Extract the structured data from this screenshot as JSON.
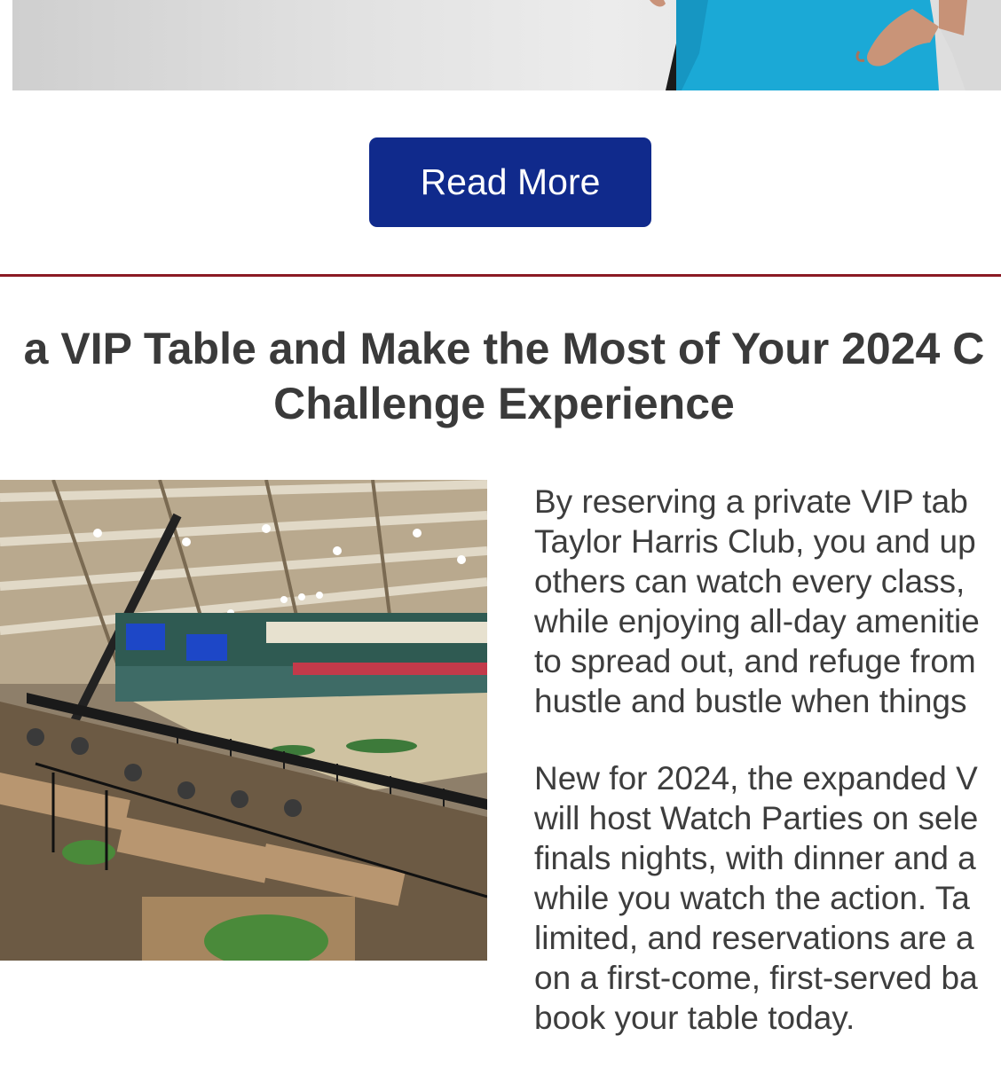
{
  "hero": {
    "image_description_icon": "person-photo-icon"
  },
  "cta": {
    "read_more_label": "Read More"
  },
  "section": {
    "headline_lines": [
      "a VIP Table and Make the Most of Your 2024 C",
      "Challenge Experience"
    ],
    "paragraph1_lines": [
      "By reserving a private VIP tab",
      "Taylor Harris Club, you and up",
      "others can watch every class,",
      "while enjoying all-day amenitie",
      "to spread out, and refuge from",
      "hustle and bustle when things"
    ],
    "paragraph2_lines": [
      "New for 2024, the expanded V",
      "will host Watch Parties on sele",
      "finals nights, with dinner and a",
      "while you watch the action. Ta",
      "limited, and reservations are a",
      "on a first-come, first-served ba",
      "book your table today."
    ]
  },
  "colors": {
    "button_bg": "#102a8c",
    "divider": "#8b1a24",
    "heading_text": "#3a3a3a",
    "body_text": "#3d3d3d"
  }
}
